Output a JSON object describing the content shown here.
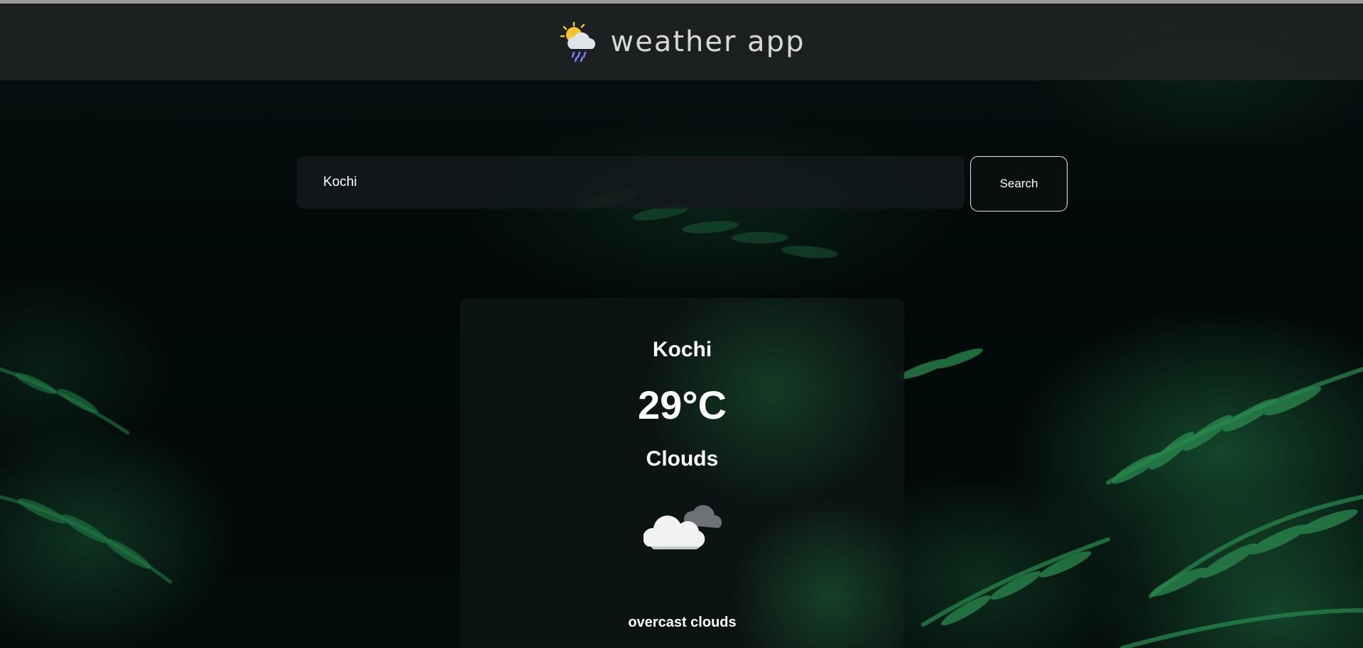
{
  "header": {
    "title": "weather app",
    "logo_icon": "sun-behind-rain-cloud-icon"
  },
  "search": {
    "value": "Kochi",
    "button_label": "Search"
  },
  "weather": {
    "city": "Kochi",
    "temperature": "29°C",
    "condition": "Clouds",
    "condition_icon": "clouds-icon",
    "description": "overcast clouds"
  },
  "colors": {
    "header_bg": "#222426",
    "card_bg": "#0c1414",
    "text": "#ffffff",
    "foliage": "#1e7a45"
  }
}
